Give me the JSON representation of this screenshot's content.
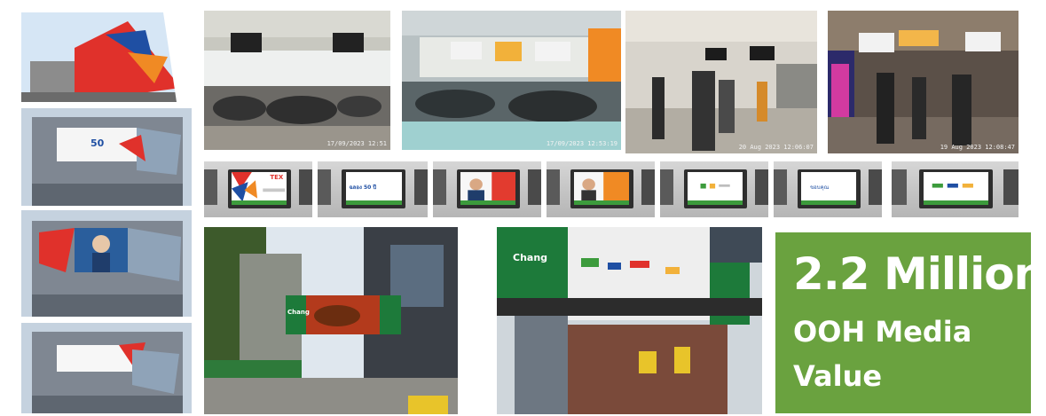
{
  "stat": {
    "headline": "2.2 Million",
    "line2": "OOH Media",
    "line3": "Value"
  },
  "photos": {
    "building_facade": {
      "alt": "Building facade with triangular graphic"
    },
    "building_screen_1": {
      "sign_text": "50"
    },
    "building_screen_2": {
      "sign_text": ""
    },
    "building_screen_3": {
      "sign_text": ""
    },
    "canteen": {
      "stamp": "17/09/2023 12:51"
    },
    "food_court": {
      "stamp": "17/09/2023 12:53:19"
    },
    "lobby": {
      "stamp": "20 Aug 2023 12:06:07"
    },
    "mall": {
      "stamp": "19 Aug 2023 12:08:47"
    },
    "street_billboard": {
      "sign_text": "Chang"
    },
    "overpass_billboard": {
      "sign_text": "Chang"
    }
  },
  "screens": [
    {
      "id": "s1",
      "text": "TEX"
    },
    {
      "id": "s2",
      "text": "ฉลอง 50 ปี"
    },
    {
      "id": "s3",
      "text": ""
    },
    {
      "id": "s4",
      "text": ""
    },
    {
      "id": "s5",
      "text": ""
    },
    {
      "id": "s6",
      "text": "ขอบคุณ"
    },
    {
      "id": "s7",
      "text": ""
    }
  ],
  "colors": {
    "stat_bg": "#6aa23f",
    "brand_red": "#e0312b",
    "brand_blue": "#1f4fa3",
    "brand_green": "#3c9b3c"
  }
}
